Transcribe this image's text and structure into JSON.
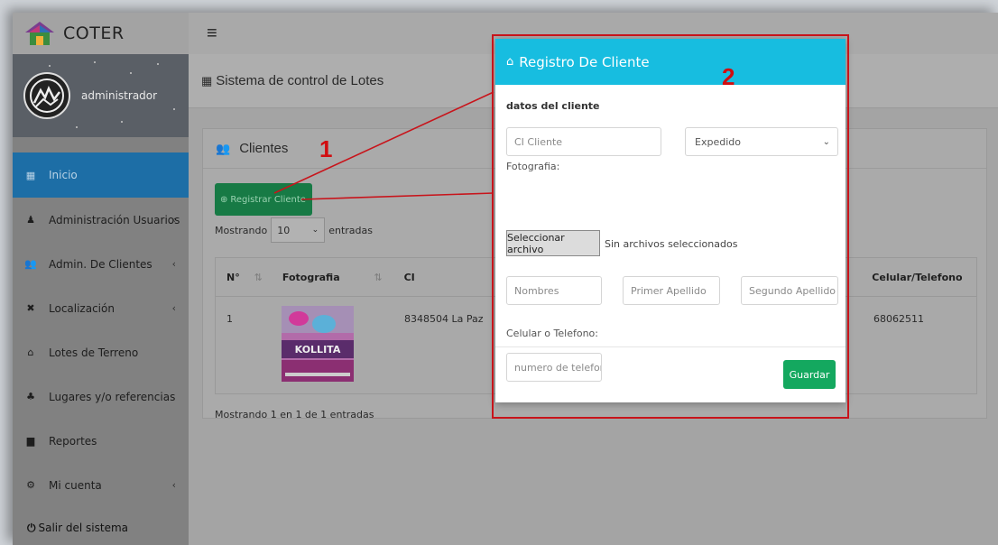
{
  "app": {
    "brand": "COTER",
    "user_name": "administrador"
  },
  "sidebar": {
    "items": [
      {
        "label": "Inicio",
        "icon": "dashboard-icon",
        "active": true,
        "has_chevron": false
      },
      {
        "label": "Administración Usuarios",
        "icon": "user-icon",
        "has_chevron": true
      },
      {
        "label": "Admin. De Clientes",
        "icon": "users-icon",
        "has_chevron": true
      },
      {
        "label": "Localización",
        "icon": "map-icon",
        "has_chevron": true
      },
      {
        "label": "Lotes de Terreno",
        "icon": "home-icon",
        "has_chevron": false
      },
      {
        "label": "Lugares y/o referencias",
        "icon": "tree-icon",
        "has_chevron": false
      },
      {
        "label": "Reportes",
        "icon": "file-icon",
        "has_chevron": false
      },
      {
        "label": "Mi cuenta",
        "icon": "gears-icon",
        "has_chevron": true
      }
    ],
    "logout": "Salir del sistema"
  },
  "content": {
    "header": "Sistema de control de Lotes",
    "card_title": "Clientes",
    "register_button": "Registrar Cliente",
    "showing_prefix": "Mostrando",
    "page_length": "10",
    "showing_suffix": "entradas",
    "table": {
      "columns": [
        "N°",
        "Fotografia",
        "CI",
        "Celular/Telefono"
      ],
      "rows": [
        {
          "n": "1",
          "photo_caption": "KOLLITA",
          "ci": "8348504 La Paz",
          "phone": "68062511"
        }
      ]
    },
    "showing_info": "Mostrando 1 en 1 de 1 entradas"
  },
  "modal": {
    "title": "Registro De Cliente",
    "section_label": "datos del cliente",
    "ci_placeholder": "CI Cliente",
    "expedido_placeholder": "Expedido",
    "photo_label": "Fotografia:",
    "file_button": "Seleccionar archivo",
    "file_status": "Sin archivos seleccionados",
    "nombres_placeholder": "Nombres",
    "primer_apellido_placeholder": "Primer Apellido",
    "segundo_apellido_placeholder": "Segundo Apellido",
    "phone_label": "Celular o Telefono:",
    "phone_placeholder": "numero de telefono",
    "save_button": "Guardar"
  },
  "annotations": {
    "label_1": "1",
    "label_2": "2",
    "color": "#c8141b"
  },
  "colors": {
    "modal_header": "#17bde0",
    "save_button": "#14a85f",
    "sidebar_active": "#1d6ea6"
  }
}
